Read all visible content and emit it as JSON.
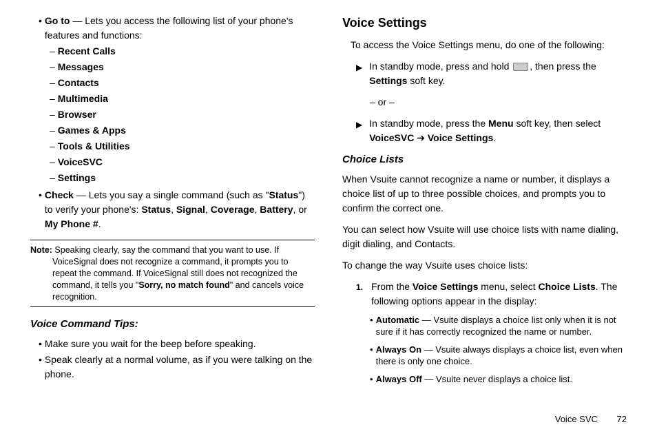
{
  "left": {
    "goto_label": "Go to",
    "goto_desc": " — Lets you access the following list of your phone's features and functions:",
    "goto_items": [
      "Recent Calls",
      "Messages",
      "Contacts",
      "Multimedia",
      "Browser",
      "Games & Apps",
      "Tools & Utilities",
      "VoiceSVC",
      "Settings"
    ],
    "check_label": "Check",
    "check_desc_pre": " — Lets you say a single command (such as \"",
    "check_status": "Status",
    "check_desc_post": "\") to verify your phone's: ",
    "check_items": "Status, Signal, Coverage, Battery, or My Phone #",
    "check_terminal": ".",
    "check_b1": "Status",
    "check_sep1": ", ",
    "check_b2": "Signal",
    "check_sep2": ", ",
    "check_b3": "Coverage",
    "check_sep3": ", ",
    "check_b4": "Battery",
    "check_sep4": ", or ",
    "check_b5": "My Phone #",
    "note_label": "Note:",
    "note_text_pre": " Speaking clearly, say the command that you want to use. If VoiceSignal does not recognize a command, it prompts you to repeat the command. If VoiceSignal still does not recognized the command, it tells you \"",
    "note_bold": "Sorry, no match found",
    "note_text_post": "\" and cancels voice recognition.",
    "tips_head": "Voice Command Tips:",
    "tip1": "Make sure you wait for the beep before speaking.",
    "tip2": "Speak clearly at a normal volume, as if you were talking on the phone."
  },
  "right": {
    "head": "Voice Settings",
    "intro": "To access the Voice Settings menu, do one of the following:",
    "step1_pre": "In standby mode, press and hold ",
    "step1_post": ", then press the ",
    "step1_bold": "Settings",
    "step1_tail": " soft key.",
    "or": "– or –",
    "step2_pre": "In standby mode, press the ",
    "step2_b1": "Menu",
    "step2_mid": " soft key, then select ",
    "step2_b2": "VoiceSVC",
    "step2_arrow": " ➔ ",
    "step2_b3": "Voice Settings",
    "step2_tail": ".",
    "choice_head": "Choice Lists",
    "choice_p1": "When Vsuite cannot recognize a name or number, it displays a choice list of up to three possible choices, and prompts you to confirm the correct one.",
    "choice_p2": "You can select how Vsuite will use choice lists with name dialing, digit dialing, and Contacts.",
    "choice_p3": "To change the way Vsuite uses choice lists:",
    "num1_pre": "From the ",
    "num1_b1": "Voice Settings",
    "num1_mid": " menu, select ",
    "num1_b2": "Choice Lists",
    "num1_post": ". The following options appear in the display:",
    "opt1_label": "Automatic",
    "opt1_desc": " — Vsuite displays a choice list only when it is not sure if it has correctly recognized the name or number.",
    "opt2_label": "Always On",
    "opt2_desc": " — Vsuite always displays a choice list, even when there is only one choice.",
    "opt3_label": "Always Off",
    "opt3_desc": " — Vsuite never displays a choice list."
  },
  "footer": {
    "section": "Voice SVC",
    "page": "72"
  }
}
